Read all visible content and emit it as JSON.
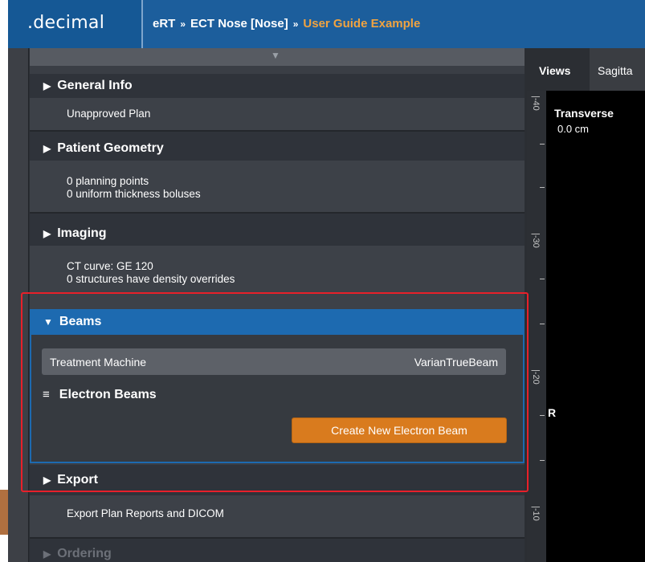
{
  "header": {
    "logo": ".decimal",
    "breadcrumb": [
      "eRT",
      "ECT Nose [Nose]",
      "User Guide Example"
    ],
    "separator": "»"
  },
  "panel": {
    "sections": {
      "general_info": {
        "title": "General Info",
        "lines": [
          "Unapproved Plan"
        ]
      },
      "patient_geometry": {
        "title": "Patient Geometry",
        "lines": [
          "0 planning points",
          "0 uniform thickness boluses"
        ]
      },
      "imaging": {
        "title": "Imaging",
        "lines": [
          "CT curve: GE 120",
          "0 structures have density overrides"
        ]
      },
      "beams": {
        "title": "Beams",
        "machine_label": "Treatment Machine",
        "machine_value": "VarianTrueBeam",
        "electron_title": "Electron Beams",
        "create_button": "Create New Electron Beam"
      },
      "export": {
        "title": "Export",
        "lines": [
          "Export Plan Reports and DICOM"
        ]
      },
      "ordering": {
        "title": "Ordering"
      }
    }
  },
  "viewer": {
    "tabs": [
      "Views",
      "Sagitta"
    ],
    "view_title": "Transverse",
    "depth": "0.0 cm",
    "orientation": "R",
    "ruler_labels": [
      "|-40",
      "|-30",
      "|-20",
      "|-10"
    ]
  },
  "colors": {
    "header": "#1c5e9c",
    "accent_breadcrumb": "#f0a340",
    "beams_header": "#1d6ab0",
    "create_button": "#d97b1e",
    "highlight": "#e8202a"
  }
}
